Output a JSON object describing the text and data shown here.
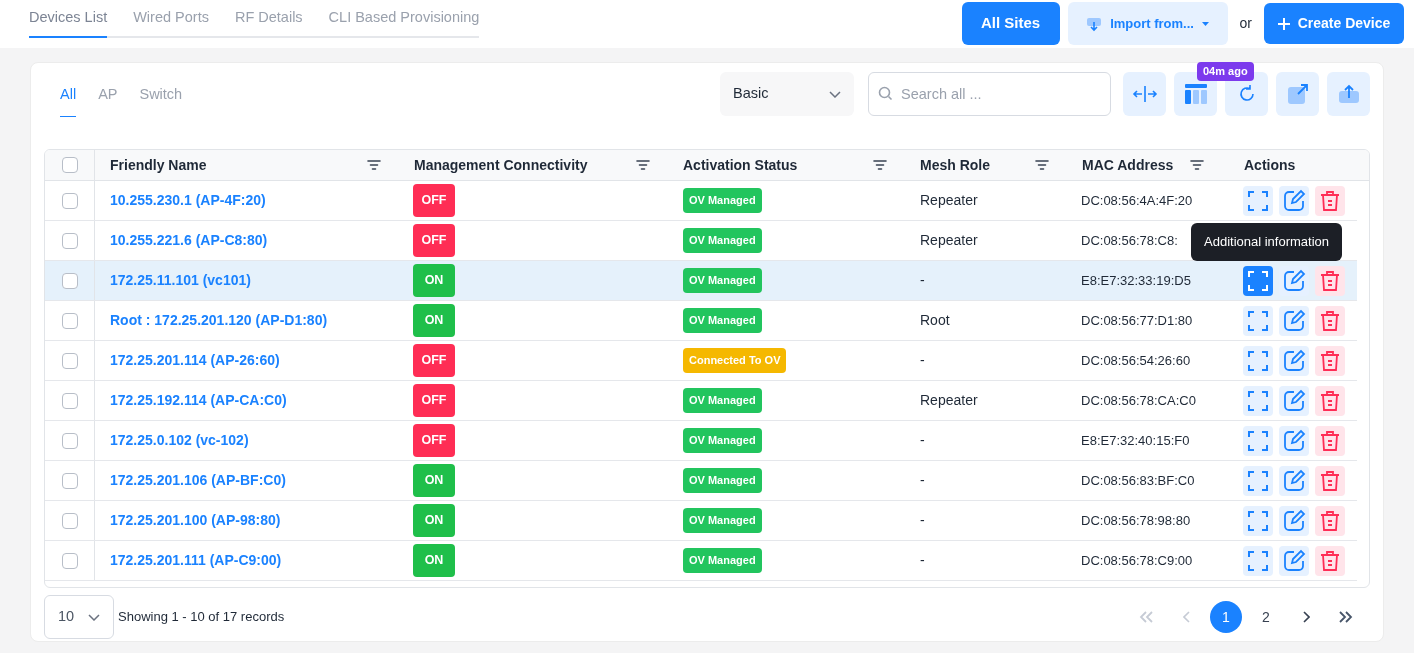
{
  "top_tabs": [
    {
      "label": "Devices List",
      "selected": true
    },
    {
      "label": "Wired Ports",
      "selected": false
    },
    {
      "label": "RF Details",
      "selected": false
    },
    {
      "label": "CLI Based Provisioning",
      "selected": false
    }
  ],
  "header_actions": {
    "all_sites": "All Sites",
    "import": "Import from...",
    "or": "or",
    "create": "Create Device"
  },
  "filter_tabs": [
    {
      "label": "All",
      "selected": true
    },
    {
      "label": "AP",
      "selected": false
    },
    {
      "label": "Switch",
      "selected": false
    }
  ],
  "view_select": "Basic",
  "search": {
    "placeholder": "Search all ..."
  },
  "refresh_badge": "04m ago",
  "select_all": {
    "checked": false
  },
  "columns": [
    "Friendly Name",
    "Management Connectivity",
    "Activation Status",
    "Mesh Role",
    "MAC Address",
    "Actions"
  ],
  "rows": [
    {
      "checked": false,
      "name": "10.255.230.1 (AP-4F:20)",
      "connectivity": "OFF",
      "on": false,
      "status": "OV Managed",
      "color": "#22c55e",
      "mesh": "Repeater",
      "mac": "DC:08:56:4A:4F:20",
      "selected": false,
      "actions_visible": true
    },
    {
      "checked": false,
      "name": "10.255.221.6 (AP-C8:80)",
      "connectivity": "OFF",
      "on": false,
      "status": "OV Managed",
      "color": "#22c55e",
      "mesh": "Repeater",
      "mac": "DC:08:56:78:C8:",
      "selected": false,
      "actions_visible": false
    },
    {
      "checked": false,
      "name": "172.25.11.101 (vc101)",
      "connectivity": "ON",
      "on": true,
      "status": "OV Managed",
      "color": "#22c55e",
      "mesh": "-",
      "mac": "E8:E7:32:33:19:D5",
      "selected": true,
      "actions_visible": true
    },
    {
      "checked": false,
      "name": "Root : 172.25.201.120 (AP-D1:80)",
      "connectivity": "ON",
      "on": true,
      "status": "OV Managed",
      "color": "#22c55e",
      "mesh": "Root",
      "mac": "DC:08:56:77:D1:80",
      "selected": false,
      "actions_visible": true
    },
    {
      "checked": false,
      "name": "172.25.201.114 (AP-26:60)",
      "connectivity": "OFF",
      "on": false,
      "status": "Connected To OV",
      "color": "#f5b800",
      "mesh": "-",
      "mac": "DC:08:56:54:26:60",
      "selected": false,
      "actions_visible": true
    },
    {
      "checked": false,
      "name": "172.25.192.114 (AP-CA:C0)",
      "connectivity": "OFF",
      "on": false,
      "status": "OV Managed",
      "color": "#22c55e",
      "mesh": "Repeater",
      "mac": "DC:08:56:78:CA:C0",
      "selected": false,
      "actions_visible": true
    },
    {
      "checked": false,
      "name": "172.25.0.102 (vc-102)",
      "connectivity": "OFF",
      "on": false,
      "status": "OV Managed",
      "color": "#22c55e",
      "mesh": "-",
      "mac": "E8:E7:32:40:15:F0",
      "selected": false,
      "actions_visible": true
    },
    {
      "checked": false,
      "name": "172.25.201.106 (AP-BF:C0)",
      "connectivity": "ON",
      "on": true,
      "status": "OV Managed",
      "color": "#22c55e",
      "mesh": "-",
      "mac": "DC:08:56:83:BF:C0",
      "selected": false,
      "actions_visible": true
    },
    {
      "checked": false,
      "name": "172.25.201.100 (AP-98:80)",
      "connectivity": "ON",
      "on": true,
      "status": "OV Managed",
      "color": "#22c55e",
      "mesh": "-",
      "mac": "DC:08:56:78:98:80",
      "selected": false,
      "actions_visible": true
    },
    {
      "checked": false,
      "name": "172.25.201.111 (AP-C9:00)",
      "connectivity": "ON",
      "on": true,
      "status": "OV Managed",
      "color": "#22c55e",
      "mesh": "-",
      "mac": "DC:08:56:78:C9:00",
      "selected": false,
      "actions_visible": true
    }
  ],
  "tooltip": "Additional information",
  "page_size": "10",
  "records": "Showing 1 - 10 of 17 records",
  "pages": [
    {
      "label": "1",
      "selected": true
    },
    {
      "label": "2",
      "selected": false
    }
  ]
}
